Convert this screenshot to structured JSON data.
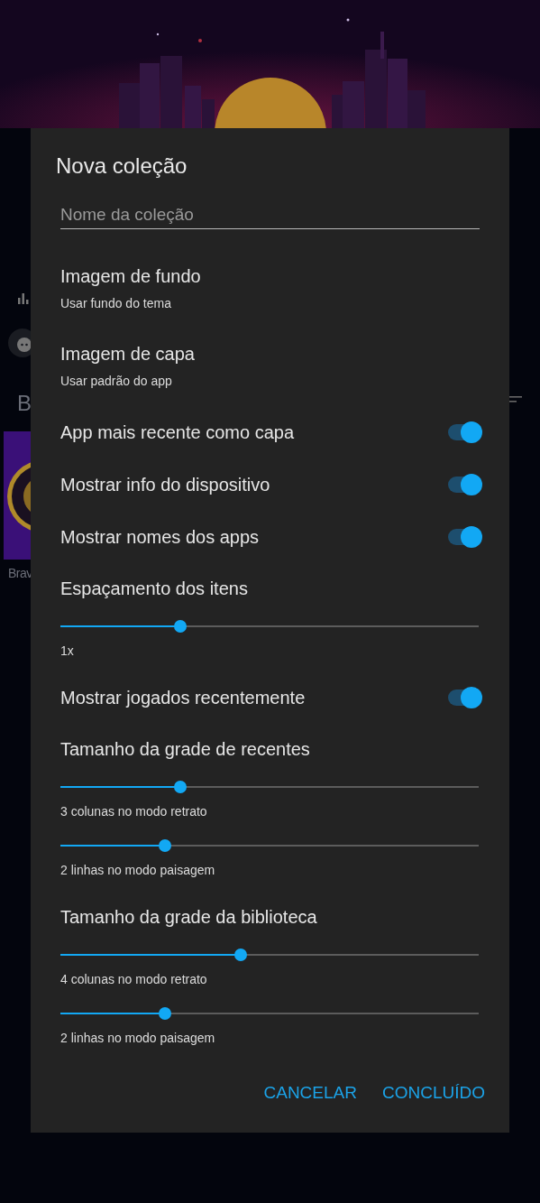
{
  "background": {
    "section_letter": "B",
    "app_label": "Brav"
  },
  "dialog": {
    "title": "Nova coleção",
    "name_field": {
      "placeholder": "Nome da coleção"
    },
    "settings": [
      {
        "kind": "option",
        "title": "Imagem de fundo",
        "subtitle": "Usar fundo do tema"
      },
      {
        "kind": "option",
        "title": "Imagem de capa",
        "subtitle": "Usar padrão do app"
      },
      {
        "kind": "toggle",
        "label": "App mais recente como capa",
        "on": true
      },
      {
        "kind": "toggle",
        "label": "Mostrar info do dispositivo",
        "on": true
      },
      {
        "kind": "toggle",
        "label": "Mostrar nomes dos apps",
        "on": true
      },
      {
        "kind": "heading",
        "label": "Espaçamento dos itens"
      },
      {
        "kind": "slider",
        "level": 0.287,
        "caption": "1x"
      },
      {
        "kind": "toggle",
        "label": "Mostrar jogados recentemente",
        "on": true
      },
      {
        "kind": "heading",
        "label": "Tamanho da grade de recentes"
      },
      {
        "kind": "slider",
        "level": 0.287,
        "caption": "3 colunas no modo retrato"
      },
      {
        "kind": "slider",
        "level": 0.25,
        "caption": "2 linhas no modo paisagem"
      },
      {
        "kind": "heading",
        "label": "Tamanho da grade da biblioteca"
      },
      {
        "kind": "slider",
        "level": 0.43,
        "caption": "4 colunas no modo retrato"
      },
      {
        "kind": "slider",
        "level": 0.25,
        "caption": "2 linhas no modo paisagem"
      }
    ],
    "buttons": [
      "CANCELAR",
      "CONCLUÍDO"
    ]
  }
}
